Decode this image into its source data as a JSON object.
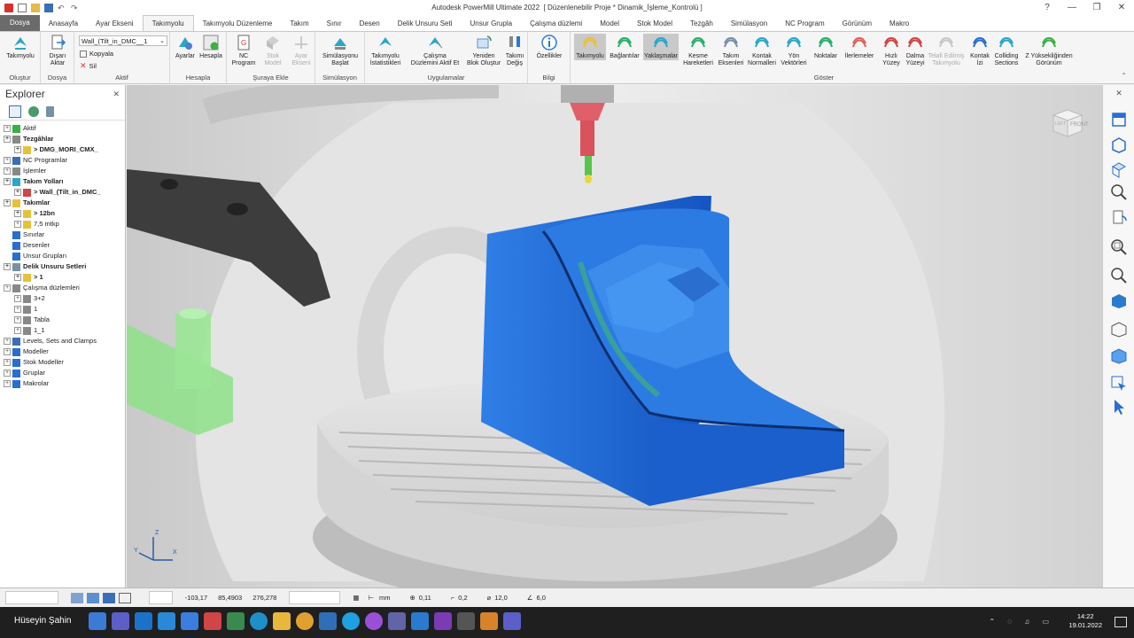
{
  "window": {
    "title": "Autodesk PowerMill Ultimate 2022",
    "project": "[ Düzenlenebilir Proje * Dinamik_İşleme_Kontrolü ]"
  },
  "tabs": [
    "Dosya",
    "Anasayfa",
    "Ayar Ekseni",
    "Takımyolu",
    "Takımyolu Düzenleme",
    "Takım",
    "Sınır",
    "Desen",
    "Delik Unsuru Seti",
    "Unsur Grupla",
    "Çalışma düzlemi",
    "Model",
    "Stok Model",
    "Tezgâh",
    "Simülasyon",
    "NC Program",
    "Görünüm",
    "Makro"
  ],
  "ribbon": {
    "olustur": {
      "label": "Oluştur",
      "btn": "Takımyolu"
    },
    "dosya": {
      "label": "Dosya",
      "btn1": "Dışarı",
      "btn2": "Aktar"
    },
    "aktif": {
      "label": "Aktif",
      "combo": "Wall_(Tilt_in_DMC__1",
      "copy": "Kopyala",
      "delete": "Sil"
    },
    "hesapla": {
      "label": "Hesapla",
      "b1": "Ayarlar",
      "b2": "Hesapla"
    },
    "suraya": {
      "label": "Şuraya Ekle",
      "b1a": "NC",
      "b1b": "Program",
      "b2a": "Stok",
      "b2b": "Model",
      "b3a": "Ayar",
      "b3b": "Ekseni"
    },
    "sim": {
      "label": "Simülasyon",
      "b1a": "Simülasyonu",
      "b1b": "Başlat"
    },
    "uyg": {
      "label": "Uygulamalar",
      "b1a": "Takımyolu",
      "b1b": "İstatistikleri",
      "b2a": "Çalışma",
      "b2b": "Düzlemini Aktif Et",
      "b3a": "Yeniden",
      "b3b": "Blok Oluştur",
      "b4a": "Takımı",
      "b4b": "Değiş"
    },
    "bilgi": {
      "label": "Bilgi",
      "b1": "Özellikler"
    },
    "goster": {
      "label": "Göster",
      "items": [
        [
          "Takımyolu",
          ""
        ],
        [
          "Bağlantılar",
          ""
        ],
        [
          "Yaklaşmalar",
          ""
        ],
        [
          "Kesme",
          "Hareketleri"
        ],
        [
          "Takım",
          "Eksenleri"
        ],
        [
          "Kontak",
          "Normalleri"
        ],
        [
          "Yön",
          "Vektörleri"
        ],
        [
          "Noktalar",
          ""
        ],
        [
          "İlerlemeler",
          ""
        ],
        [
          "Hızlı",
          "Yüzey"
        ],
        [
          "Dalma",
          "Yüzeyi"
        ],
        [
          "Telafi Edilmiş",
          "Takımyolu"
        ],
        [
          "Kontak",
          "İzi"
        ],
        [
          "Colliding",
          "Sections"
        ],
        [
          "Z Yüksekliğinden",
          "Görünüm"
        ]
      ]
    }
  },
  "explorer": {
    "title": "Explorer",
    "nodes": [
      "Aktif",
      "Tezgâhlar",
      "> DMG_MORI_CMX_",
      "NC Programlar",
      "İşlemler",
      "Takım Yolları",
      "> Wall_(Tilt_in_DMC_",
      "Takımlar",
      "> 12bn",
      "7,5 mtkp",
      "Sınırlar",
      "Desenler",
      "Unsur Grupları",
      "Delik Unsuru Setleri",
      "> 1",
      "Çalışma düzlemleri",
      "3+2",
      "1",
      "Tabla",
      "1_1",
      "Levels, Sets and Clamps",
      "Modeller",
      "Stok Modeller",
      "Gruplar",
      "Makrolar"
    ]
  },
  "viewcube": {
    "face": "FRONT",
    "side": "LEFT"
  },
  "triad": {
    "x": "X",
    "y": "Y",
    "z": "Z"
  },
  "status": {
    "x": "-103,17",
    "y": "85,4903",
    "z": "276,278",
    "unit": "mm",
    "tol": "0,11",
    "thick": "0,2",
    "dia": "12,0",
    "step": "6,0"
  },
  "taskbar": {
    "user": "Hüseyin Şahin",
    "time": "14:22",
    "date": "19.01.2022"
  },
  "colors": {
    "part": "#1f6fd8",
    "fixture": "#8ee28a",
    "spindle": "#e0606a"
  }
}
